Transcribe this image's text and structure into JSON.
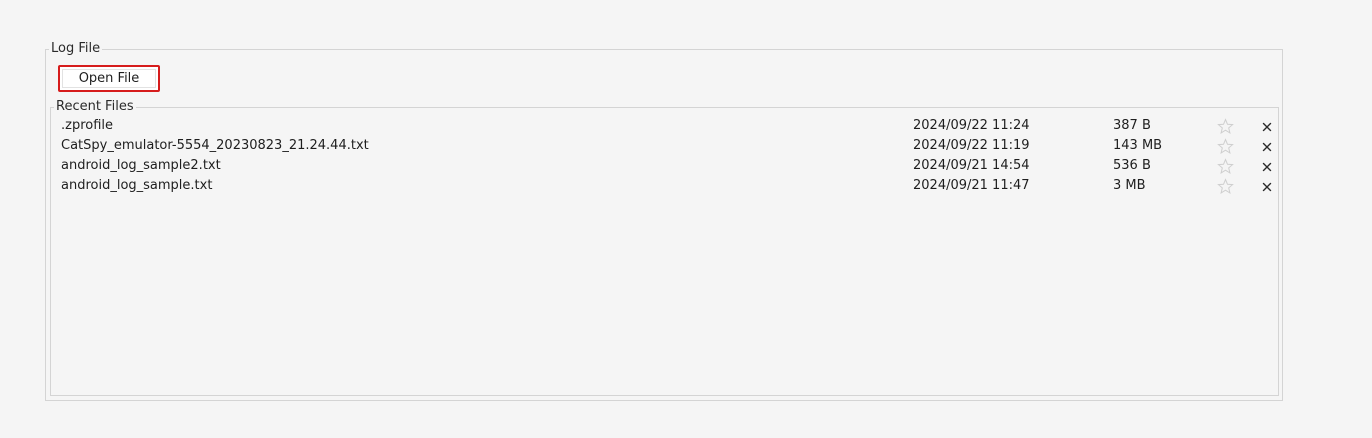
{
  "log_file_group": {
    "title": "Log File",
    "open_file_label": "Open File"
  },
  "recent_files": {
    "title": "Recent Files",
    "items": [
      {
        "name": ".zprofile",
        "date": "2024/09/22 11:24",
        "size": "387 B"
      },
      {
        "name": "CatSpy_emulator-5554_20230823_21.24.44.txt",
        "date": "2024/09/22 11:19",
        "size": "143 MB"
      },
      {
        "name": "android_log_sample2.txt",
        "date": "2024/09/21 14:54",
        "size": "536 B"
      },
      {
        "name": "android_log_sample.txt",
        "date": "2024/09/21 11:47",
        "size": "3 MB"
      }
    ],
    "row_icons": [
      "star-icon",
      "close-icon"
    ]
  },
  "colors": {
    "background": "#f5f5f5",
    "border": "#d4d4d4",
    "focus_outline": "#d61c1c",
    "star_outline": "#cfcfcf",
    "close": "#2a2a2a"
  }
}
